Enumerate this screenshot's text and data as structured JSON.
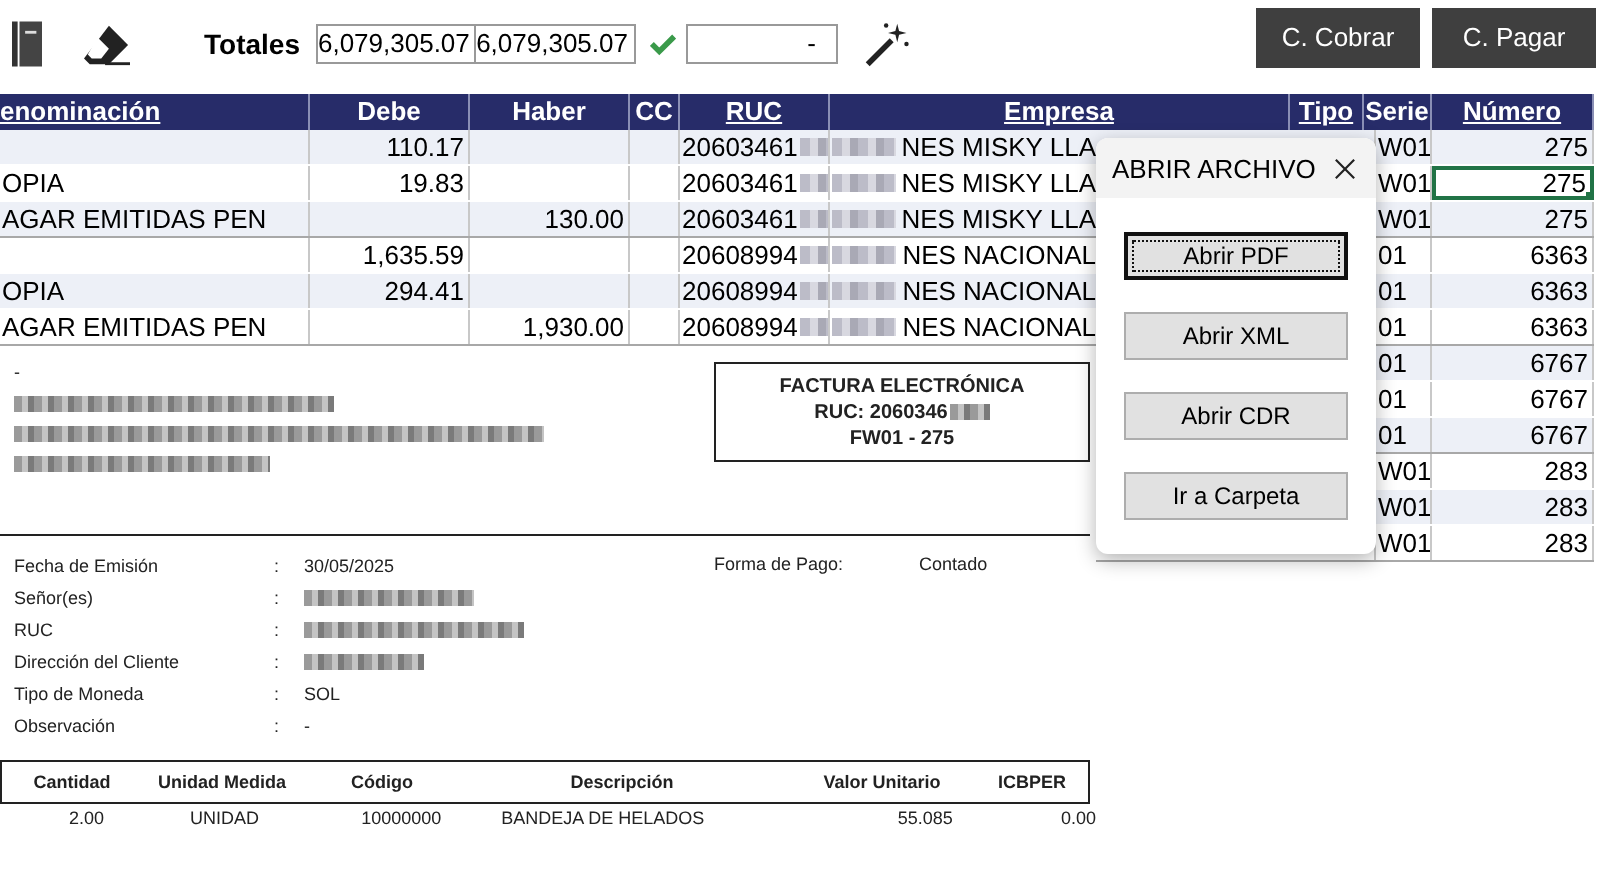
{
  "toolbar": {
    "totals_label": "Totales",
    "debe_total": "6,079,305.07",
    "haber_total": "6,079,305.07",
    "balanced": true,
    "difference": "-",
    "buttons": [
      "C. Cobrar",
      "C. Pagar"
    ]
  },
  "table": {
    "columns": [
      {
        "label": "enominación",
        "underlined": true
      },
      {
        "label": "Debe",
        "underlined": false
      },
      {
        "label": "Haber",
        "underlined": false
      },
      {
        "label": "CC",
        "underlined": false
      },
      {
        "label": "RUC",
        "underlined": true
      },
      {
        "label": "Empresa",
        "underlined": true
      },
      {
        "label": "Tipo",
        "underlined": true
      },
      {
        "label": "Serie",
        "underlined": false
      },
      {
        "label": "Número",
        "underlined": true
      }
    ],
    "rows": [
      {
        "denominacion": "",
        "debe": "110.17",
        "haber": "",
        "ruc": "20603461",
        "empresa": "NES MISKY LLA",
        "serie": "W01",
        "numero": "275",
        "selected": false
      },
      {
        "denominacion": "OPIA",
        "debe": "19.83",
        "haber": "",
        "ruc": "20603461",
        "empresa": "NES MISKY LLA",
        "serie": "W01",
        "numero": "275",
        "selected": true
      },
      {
        "denominacion": "AGAR EMITIDAS PEN",
        "debe": "",
        "haber": "130.00",
        "ruc": "20603461",
        "empresa": "NES MISKY LLA",
        "serie": "W01",
        "numero": "275",
        "selected": false
      },
      {
        "denominacion": "",
        "debe": "1,635.59",
        "haber": "",
        "ruc": "20608994",
        "empresa": "NES NACIONAL",
        "serie": "01",
        "numero": "6363",
        "selected": false
      },
      {
        "denominacion": "OPIA",
        "debe": "294.41",
        "haber": "",
        "ruc": "20608994",
        "empresa": "NES NACIONAL",
        "serie": "01",
        "numero": "6363",
        "selected": false
      },
      {
        "denominacion": "AGAR EMITIDAS PEN",
        "debe": "",
        "haber": "1,930.00",
        "ruc": "20608994",
        "empresa": "NES NACIONAL",
        "serie": "01",
        "numero": "6363",
        "selected": false
      },
      {
        "serie": "01",
        "numero": "6767",
        "selected": false
      },
      {
        "serie": "01",
        "numero": "6767",
        "selected": false
      },
      {
        "serie": "01",
        "numero": "6767",
        "selected": false
      },
      {
        "serie": "W01",
        "numero": "283",
        "selected": false
      },
      {
        "serie": "W01",
        "numero": "283",
        "selected": false
      },
      {
        "serie": "W01",
        "numero": "283",
        "selected": false
      }
    ]
  },
  "dialog": {
    "title": "ABRIR ARCHIVO",
    "buttons": [
      {
        "label": "Abrir PDF",
        "focused": true
      },
      {
        "label": "Abrir XML",
        "focused": false
      },
      {
        "label": "Abrir CDR",
        "focused": false
      },
      {
        "label": "Ir a Carpeta",
        "focused": false
      }
    ]
  },
  "document": {
    "header_dash": "-",
    "box": {
      "title": "FACTURA ELECTRÓNICA",
      "ruc_label": "RUC:",
      "ruc_value": "2060346",
      "number": "FW01 - 275"
    },
    "fields": [
      {
        "label": "Fecha de Emisión",
        "colon": ":",
        "value": "30/05/2025",
        "redacted": false
      },
      {
        "label": "Señor(es)",
        "colon": ":",
        "redacted": true
      },
      {
        "label": "RUC",
        "colon": ":",
        "redacted": true
      },
      {
        "label": "Dirección del Cliente",
        "colon": ":",
        "redacted": true
      },
      {
        "label": "Tipo de Moneda",
        "colon": ":",
        "value": "SOL",
        "redacted": false
      },
      {
        "label": "Observación",
        "colon": ":",
        "value": "-",
        "redacted": false
      }
    ],
    "payment": {
      "label": "Forma de Pago:",
      "value": "Contado"
    },
    "item_columns": [
      "Cantidad",
      "Unidad Medida",
      "Código",
      "Descripción",
      "Valor Unitario",
      "ICBPER"
    ],
    "items": [
      [
        "2.00",
        "UNIDAD",
        "10000000",
        "BANDEJA DE HELADOS",
        "55.085",
        "0.00"
      ]
    ]
  }
}
